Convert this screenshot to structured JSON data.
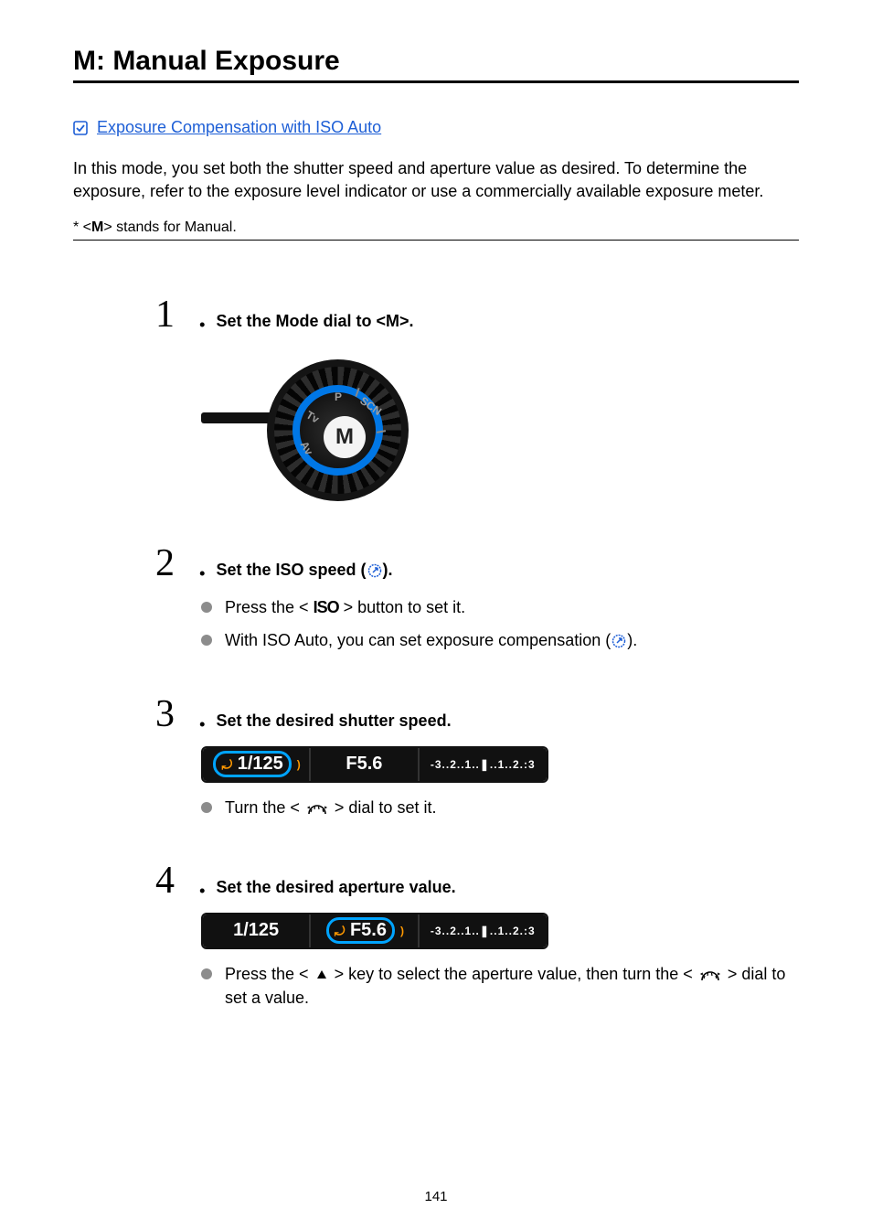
{
  "title": "M: Manual Exposure",
  "link": {
    "label": "Exposure Compensation with ISO Auto"
  },
  "intro": "In this mode, you set both the shutter speed and aperture value as desired. To determine the exposure, refer to the exposure level indicator or use a commercially available exposure meter.",
  "footnote_prefix": " * <",
  "footnote_m": "M",
  "footnote_suffix": "> stands for Manual.",
  "steps": {
    "s1": {
      "num": "1",
      "title_pre": "Set the Mode dial to <",
      "title_mode": "M",
      "title_post": ">.",
      "dial": {
        "center": "M",
        "top": "P",
        "right1": "SCN",
        "left1": "Av",
        "left2": "Tv"
      }
    },
    "s2": {
      "num": "2",
      "title_pre": "Set the ISO speed (",
      "title_post": ").",
      "bullet1_pre": "Press the < ",
      "bullet1_iso": "ISO",
      "bullet1_post": " > button to set it.",
      "bullet2_pre": "With ISO Auto, you can set exposure compensation (",
      "bullet2_post": ")."
    },
    "s3": {
      "num": "3",
      "title": "Set the desired shutter speed.",
      "lcd": {
        "shutter": "1/125",
        "aperture": "F5.6",
        "scale": "-3..2..1..❚..1..2.:3"
      },
      "bullet_pre": "Turn the < ",
      "bullet_post": " > dial to set it."
    },
    "s4": {
      "num": "4",
      "title": "Set the desired aperture value.",
      "lcd": {
        "shutter": "1/125",
        "aperture": "F5.6",
        "scale": "-3..2..1..❚..1..2.:3"
      },
      "bullet_pre": "Press the < ",
      "bullet_mid": " > key to select the aperture value, then turn the < ",
      "bullet_post": " > dial to set a value."
    }
  },
  "page_number": "141"
}
